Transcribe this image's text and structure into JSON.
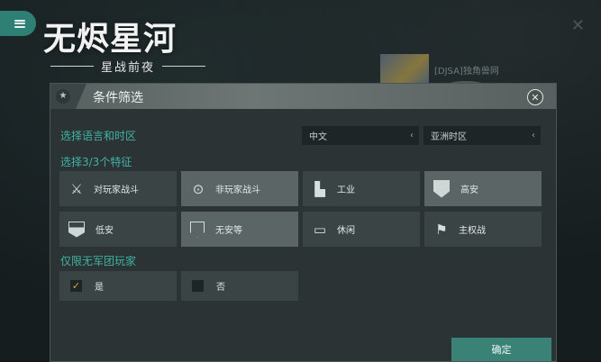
{
  "app": {
    "logo_title": "无烬星河",
    "logo_subtitle": "星战前夜",
    "background_user": "[DJSA]独角兽网"
  },
  "dialog": {
    "title": "条件筛选",
    "language_section_label": "选择语言和时区",
    "language_select": {
      "value": "中文"
    },
    "timezone_select": {
      "value": "亚洲时区"
    },
    "features_section_label": "选择3/3个特征",
    "features": [
      {
        "label": "对玩家战斗",
        "icon": "crossed-swords-icon",
        "selected": false
      },
      {
        "label": "非玩家战斗",
        "icon": "target-reticle-icon",
        "selected": true
      },
      {
        "label": "工业",
        "icon": "factory-icon",
        "selected": false
      },
      {
        "label": "高安",
        "icon": "shield-filled-icon",
        "selected": true
      },
      {
        "label": "低安",
        "icon": "shield-half-icon",
        "selected": false
      },
      {
        "label": "无安等",
        "icon": "shield-outline-icon",
        "selected": true
      },
      {
        "label": "休闲",
        "icon": "chat-bubble-icon",
        "selected": false
      },
      {
        "label": "主权战",
        "icon": "flag-icon",
        "selected": false
      }
    ],
    "alliance_section_label": "仅限无军团玩家",
    "alliance_options": [
      {
        "label": "是",
        "checked": true
      },
      {
        "label": "否",
        "checked": false
      }
    ],
    "confirm_label": "确定"
  },
  "colors": {
    "accent": "#3fb3a4",
    "confirm_button": "#3b8276",
    "check_mark": "#e0a53c"
  }
}
